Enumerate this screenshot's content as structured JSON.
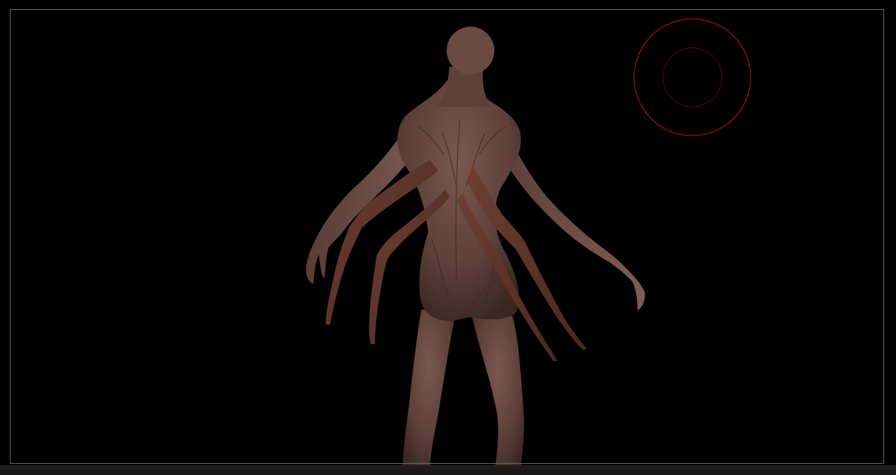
{
  "app": {
    "background_color": "#000000",
    "frame_color": "#6a6a6a"
  },
  "viewport": {
    "model": {
      "icon": "creature-sculpt",
      "skin_color": "#6b4a43",
      "limb_color": "#5e362c"
    },
    "brush_cursor": {
      "icon": "brush-cursor-icon",
      "color": "#8b0f0f"
    }
  }
}
